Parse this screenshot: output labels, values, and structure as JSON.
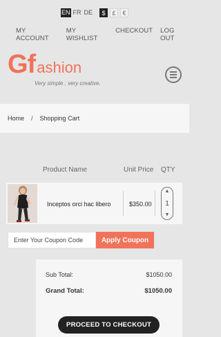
{
  "languages": {
    "items": [
      "EN",
      "FR",
      "DE"
    ],
    "active": "EN"
  },
  "currencies": {
    "items": [
      "$",
      "£",
      "€"
    ],
    "active": "$"
  },
  "account_nav": {
    "items": [
      "MY ACCOUNT",
      "MY WISHLIST",
      "CHECKOUT",
      "LOG OUT"
    ]
  },
  "logo": {
    "g": "Gf",
    "rest": "ashion",
    "tagline": "Very simple , very creative."
  },
  "breadcrumb": {
    "home": "Home",
    "separator": "/",
    "current": "Shopping Cart"
  },
  "cart_table": {
    "headers": {
      "product": "Product Name",
      "unit_price": "Unit Price",
      "qty": "QTY"
    },
    "rows": [
      {
        "name": "Inceptos orci hac libero",
        "price": "$350.00",
        "qty": "1"
      }
    ]
  },
  "coupon": {
    "placeholder": "Enter Your Coupon Code",
    "button_label": "Apply Coupon"
  },
  "totals": {
    "subtotal_label": "Sub Total:",
    "subtotal_value": "$1050.00",
    "grand_label": "Grand Total:",
    "grand_value": "$1050.00"
  },
  "checkout": {
    "button_label": "PROCEED TO CHECKOUT"
  },
  "colors": {
    "accent": "#f0735a",
    "dark": "#222222",
    "background": "#e6e6e6",
    "panel": "#f6f6f6"
  }
}
